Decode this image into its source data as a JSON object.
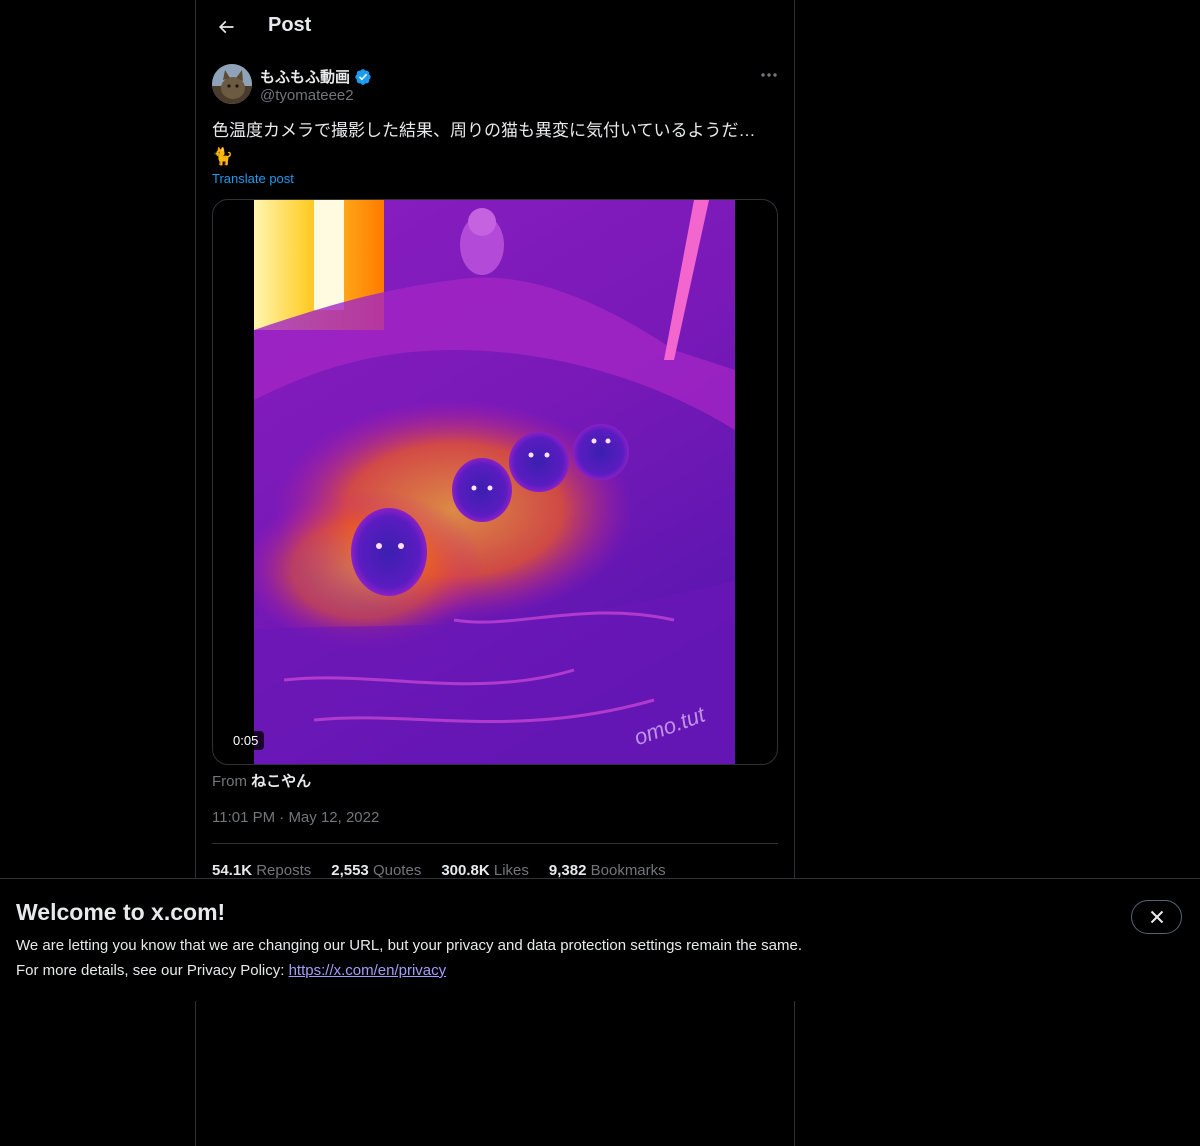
{
  "header": {
    "title": "Post"
  },
  "post": {
    "display_name": "もふもふ動画",
    "handle": "@tyomateee2",
    "text_line1": "色温度カメラで撮影した結果、周りの猫も異変に気付いているようだ…",
    "text_line2": "🐈",
    "translate_label": "Translate post",
    "media": {
      "duration": "0:05",
      "watermark": "omo.tut"
    },
    "from_prefix": "From",
    "from_source": "ねこやん",
    "time": "11:01 PM",
    "separator": "·",
    "date": "May 12, 2022",
    "stats": [
      {
        "value": "54.1K",
        "label": "Reposts"
      },
      {
        "value": "2,553",
        "label": "Quotes"
      },
      {
        "value": "300.8K",
        "label": "Likes"
      },
      {
        "value": "9,382",
        "label": "Bookmarks"
      }
    ]
  },
  "banner": {
    "title": "Welcome to x.com!",
    "line1": "We are letting you know that we are changing our URL, but your privacy and data protection settings remain the same.",
    "line2_prefix": "For more details, see our Privacy Policy: ",
    "link": "https://x.com/en/privacy"
  },
  "colors": {
    "accent": "#1d9bf0",
    "link_in_banner": "#a29ef7",
    "muted": "#71767b",
    "border": "#2f3336"
  },
  "icons": [
    "back-arrow-icon",
    "verified-badge-icon",
    "more-icon",
    "close-icon"
  ]
}
